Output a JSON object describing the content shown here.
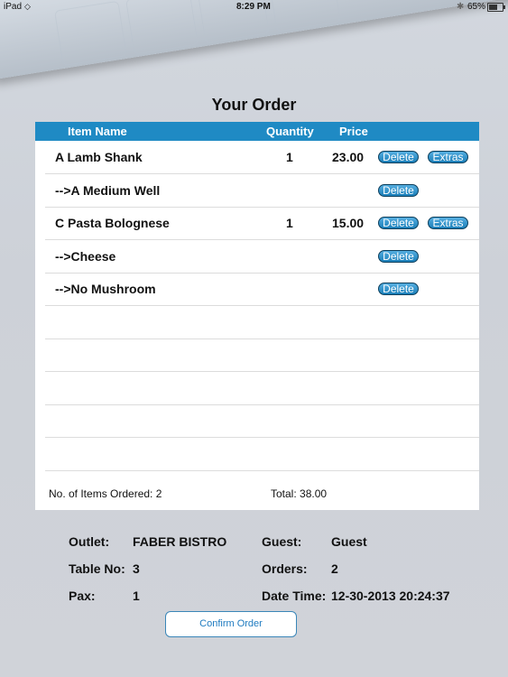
{
  "status_bar": {
    "device": "iPad",
    "time": "8:29 PM",
    "battery": "65%",
    "battery_level": 0.65
  },
  "page_title": "Your Order",
  "table": {
    "columns": [
      "Item Name",
      "Quantity",
      "Price"
    ],
    "rows": [
      {
        "name": "A Lamb Shank",
        "quantity": "1",
        "price": "23.00",
        "delete": "Delete",
        "extras": "Extras"
      },
      {
        "name": "-->A Medium Well",
        "quantity": "",
        "price": "",
        "delete": "Delete",
        "extras": ""
      },
      {
        "name": "C Pasta Bolognese",
        "quantity": "1",
        "price": "15.00",
        "delete": "Delete",
        "extras": "Extras"
      },
      {
        "name": "-->Cheese",
        "quantity": "",
        "price": "",
        "delete": "Delete",
        "extras": ""
      },
      {
        "name": "-->No Mushroom",
        "quantity": "",
        "price": "",
        "delete": "Delete",
        "extras": ""
      }
    ],
    "items_ordered": "No. of Items Ordered: 2",
    "total": "Total:  38.00"
  },
  "info": {
    "outlet_label": "Outlet:",
    "outlet_value": "FABER BISTRO",
    "guest_label": "Guest:",
    "guest_value": "Guest",
    "table_label": "Table No:",
    "table_value": "3",
    "orders_label": "Orders:",
    "orders_value": "2",
    "pax_label": "Pax:",
    "pax_value": "1",
    "datetime_label": "Date Time:",
    "datetime_value": "12-30-2013 20:24:37"
  },
  "confirm_label": "Confirm Order"
}
